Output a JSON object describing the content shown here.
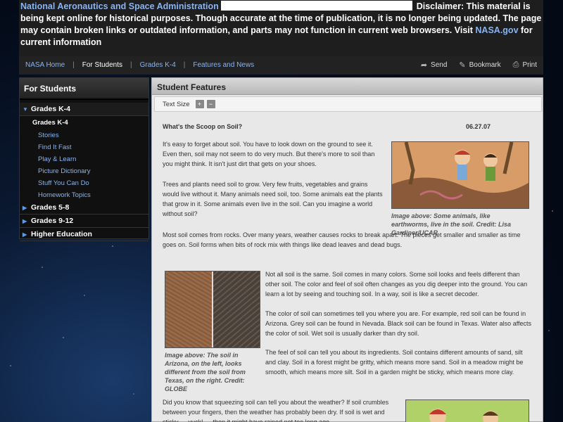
{
  "disclaimer": {
    "org": "National Aeronautics and Space Administration",
    "text": "Disclaimer: This material is being kept online for historical purposes. Though accurate at the time of publication, it is no longer being updated. The page may contain broken links or outdated information, and parts may not function in current web browsers. Visit",
    "link": "NASA.gov",
    "suffix": "for current information"
  },
  "nav": {
    "items": [
      {
        "label": "NASA Home"
      },
      {
        "label": "For Students"
      },
      {
        "label": "Grades K-4"
      },
      {
        "label": "Features and News"
      }
    ],
    "sep": "|",
    "tools": [
      {
        "label": "Send",
        "icon": "send-icon"
      },
      {
        "label": "Bookmark",
        "icon": "bookmark-icon"
      },
      {
        "label": "Print",
        "icon": "print-icon"
      }
    ]
  },
  "sidebar": {
    "title": "For Students",
    "sections": [
      {
        "label": "Grades K-4",
        "open": true
      },
      {
        "label": "Grades 5-8"
      },
      {
        "label": "Grades 9-12"
      },
      {
        "label": "Higher Education"
      }
    ],
    "sub_title": "Grades K-4",
    "items": [
      "Stories",
      "Find It Fast",
      "Play & Learn",
      "Picture Dictionary",
      "Stuff You Can Do",
      "Homework Topics"
    ]
  },
  "main": {
    "header": "Student Features",
    "text_size_label": "Text Size",
    "plus": "+",
    "minus": "−"
  },
  "article": {
    "title": "What's the Scoop on Soil?",
    "date": "06.27.07",
    "p1": "It's easy to forget about soil. You have to look down on the ground to see it. Even then, soil may not seem to do very much. But there's more to soil than you might think. It isn't just dirt that gets on your shoes.",
    "p2": "Trees and plants need soil to grow. Very few fruits, vegetables and grains would live without it. Many animals need soil, too. Some animals eat the plants that grow in it. Some animals even live in the soil. Can you imagine a world without soil?",
    "p3": "Most soil comes from rocks. Over many years, weather causes rocks to break apart. The pieces get smaller and smaller as time goes on. Soil forms when bits of rock mix with things like dead leaves and dead bugs.",
    "p4": "Not all soil is the same. Soil comes in many colors. Some soil looks and feels different than other soil. The color and feel of soil often changes as you dig deeper into the ground. You can learn a lot by seeing and touching soil. In a way, soil is like a secret decoder.",
    "p5": "The color of soil can sometimes tell you where you are. For example, red soil can be found in Arizona. Grey soil can be found in Nevada. Black soil can be found in Texas. Water also affects the color of soil. Wet soil is usually darker than dry soil.",
    "p6": "The feel of soil can tell you about its ingredients. Soil contains different amounts of sand, silt and clay. Soil in a forest might be gritty, which means more sand. Soil in a meadow might be smooth, which means more silt. Soil in a garden might be sticky, which means more clay.",
    "p7": "Did you know that squeezing soil can tell you about the weather? If soil crumbles between your fingers, then the weather has probably been dry. If soil is wet and sticky — yuck! — then it might have rained not too long ago.",
    "cap1": "Image above: Some animals, like earthworms, live in the soil. Credit: Lisa Gardiner/UCAR",
    "cap2": "Image above: The soil in Arizona, on the left, looks different from the soil from Texas, on the right. Credit: GLOBE"
  }
}
